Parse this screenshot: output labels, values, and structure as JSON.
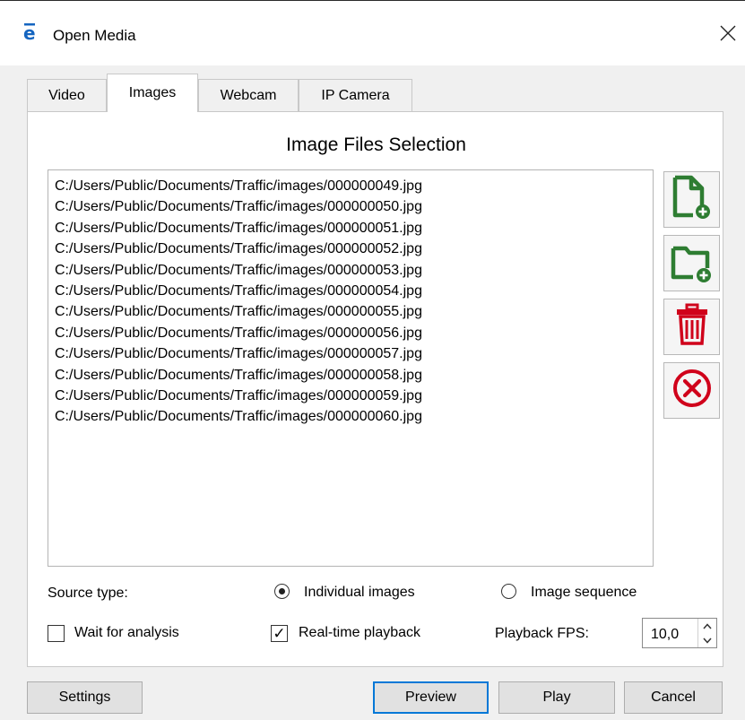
{
  "window": {
    "title": "Open Media"
  },
  "tabs": [
    {
      "label": "Video"
    },
    {
      "label": "Images"
    },
    {
      "label": "Webcam"
    },
    {
      "label": "IP Camera"
    }
  ],
  "images": {
    "section_title": "Image Files Selection",
    "files": [
      "C:/Users/Public/Documents/Traffic/images/000000049.jpg",
      "C:/Users/Public/Documents/Traffic/images/000000050.jpg",
      "C:/Users/Public/Documents/Traffic/images/000000051.jpg",
      "C:/Users/Public/Documents/Traffic/images/000000052.jpg",
      "C:/Users/Public/Documents/Traffic/images/000000053.jpg",
      "C:/Users/Public/Documents/Traffic/images/000000054.jpg",
      "C:/Users/Public/Documents/Traffic/images/000000055.jpg",
      "C:/Users/Public/Documents/Traffic/images/000000056.jpg",
      "C:/Users/Public/Documents/Traffic/images/000000057.jpg",
      "C:/Users/Public/Documents/Traffic/images/000000058.jpg",
      "C:/Users/Public/Documents/Traffic/images/000000059.jpg",
      "C:/Users/Public/Documents/Traffic/images/000000060.jpg"
    ],
    "side_buttons": [
      {
        "icon": "add-file-icon"
      },
      {
        "icon": "add-folder-icon"
      },
      {
        "icon": "trash-icon"
      },
      {
        "icon": "clear-icon"
      }
    ],
    "source_type_label": "Source type:",
    "source_options": [
      {
        "label": "Individual images",
        "checked": true
      },
      {
        "label": "Image sequence",
        "checked": false
      }
    ],
    "wait_for_analysis": {
      "label": "Wait for analysis",
      "checked": false
    },
    "realtime_playback": {
      "label": "Real-time playback",
      "checked": true
    },
    "playback_fps": {
      "label": "Playback FPS:",
      "value": "10,0"
    }
  },
  "buttons": {
    "settings": "Settings",
    "preview": "Preview",
    "play": "Play",
    "cancel": "Cancel"
  },
  "colors": {
    "icon_green": "#2e7d32",
    "icon_red": "#d0021b",
    "app_icon_blue": "#1565c0",
    "accent": "#0078d7"
  }
}
